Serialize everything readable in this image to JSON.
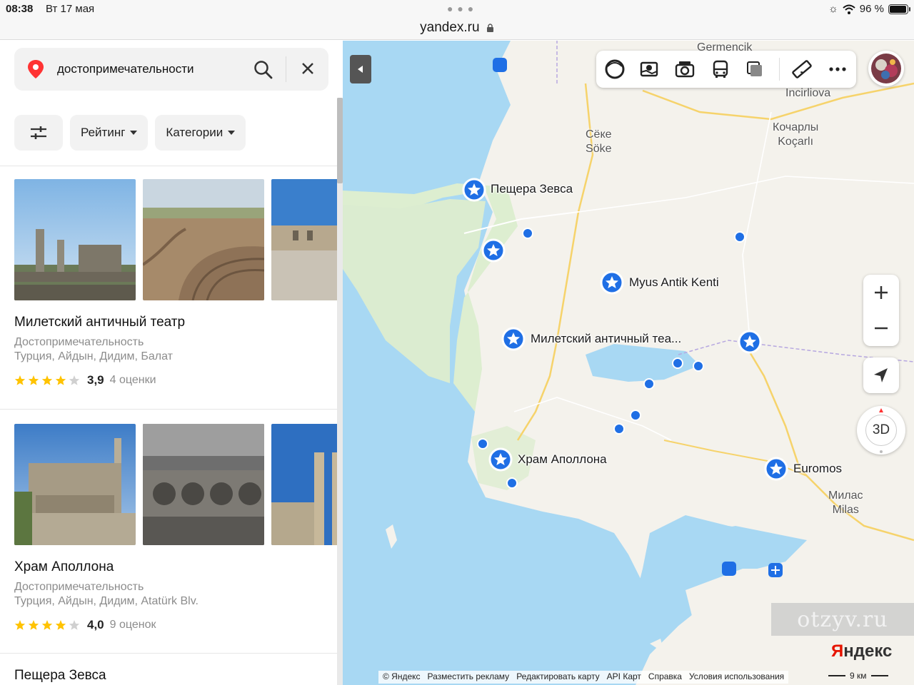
{
  "status_bar": {
    "time": "08:38",
    "date": "Вт 17 мая",
    "url": "yandex.ru",
    "battery": "96 %",
    "battery_level": 0.96
  },
  "search": {
    "value": "достопримечательности"
  },
  "filters": {
    "rating_label": "Рейтинг",
    "categories_label": "Категории"
  },
  "results": [
    {
      "title": "Милетский античный театр",
      "category": "Достопримечательность",
      "address": "Турция, Айдын, Дидим, Балат",
      "rating": "3,9",
      "rating_stars": 3.9,
      "reviews": "4 оценки"
    },
    {
      "title": "Храм Аполлона",
      "category": "Достопримечательность",
      "address": "Турция, Айдын, Дидим, Atatürk Blv.",
      "rating": "4,0",
      "rating_stars": 4.0,
      "reviews": "9 оценок"
    },
    {
      "title": "Пещера Зевса"
    }
  ],
  "map": {
    "pois": [
      "Пещера Зевса",
      "Myus Antik Kenti",
      "Милетский античный теа...",
      "Храм Аполлона",
      "Euromos"
    ],
    "cities": {
      "germencik": "Germencik",
      "incirliova": "İncirliova",
      "soke_ru": "Сёке",
      "soke": "Söke",
      "kocarly_ru": "Кочарлы",
      "kocarli": "Koçarlı",
      "milas_ru": "Милас",
      "milas": "Milas"
    },
    "btn_3d": "3D",
    "watermark": "otzyv.ru",
    "logo_first": "Я",
    "logo_rest": "ндекс",
    "footer": {
      "copyright": "© Яндекс",
      "ads": "Разместить рекламу",
      "edit": "Редактировать карту",
      "api": "API Карт",
      "help": "Справка",
      "terms": "Условия использования"
    },
    "scale": "9 км",
    "colors": {
      "water": "#a8d8f3",
      "land": "#f4f2ec",
      "park": "#ddeed0",
      "poi": "#1f6fe5",
      "star": "#ffc300"
    }
  }
}
